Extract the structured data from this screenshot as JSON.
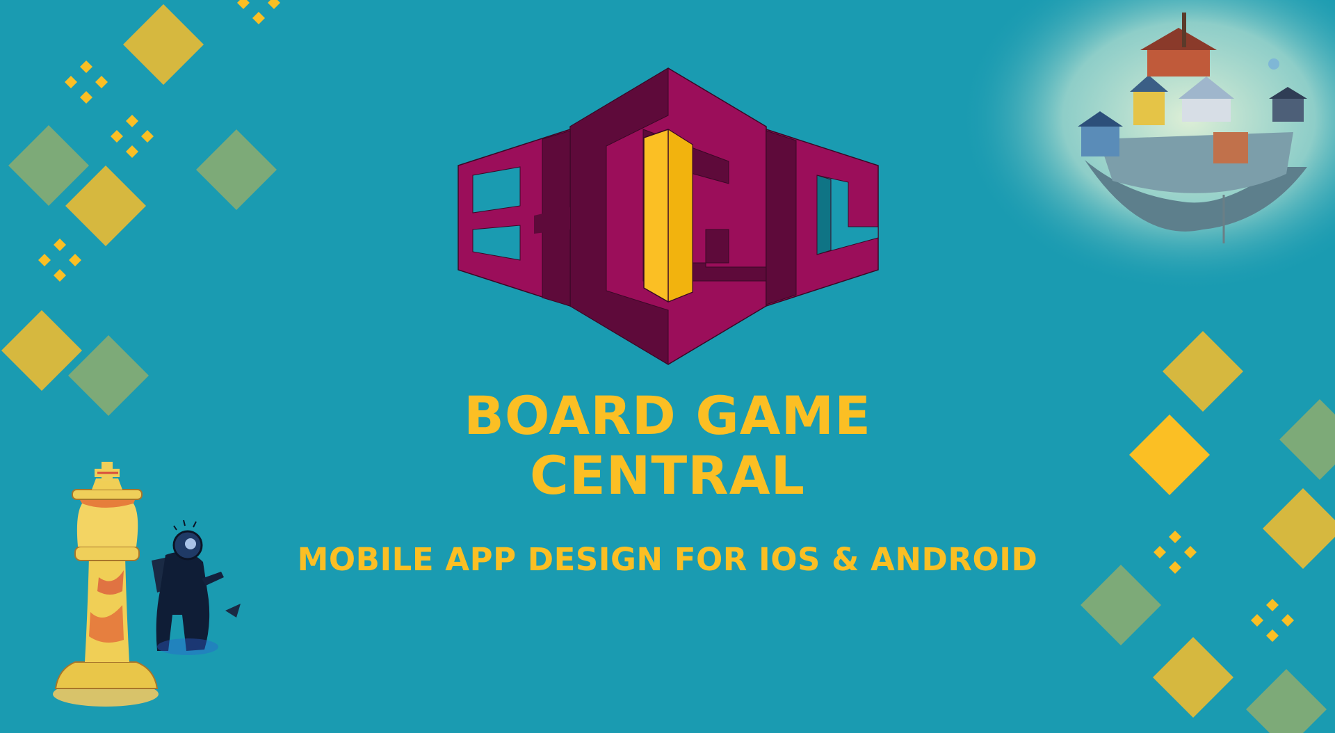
{
  "title": {
    "line1": "BOARD GAME",
    "line2": "CENTRAL"
  },
  "subtitle": "MOBILE APP DESIGN FOR IOS & ANDROID",
  "logo": {
    "letters": "BGC"
  },
  "colors": {
    "background": "#1a9bb1",
    "accent_yellow": "#fbbf24",
    "diamond_yellow": "#d6b83f",
    "diamond_green": "#7daa78",
    "logo_magenta": "#9b0e5a",
    "logo_dark": "#5e0a3a"
  },
  "illustrations": [
    "floating-island-illustration",
    "chess-king-figure",
    "diver-figure"
  ]
}
